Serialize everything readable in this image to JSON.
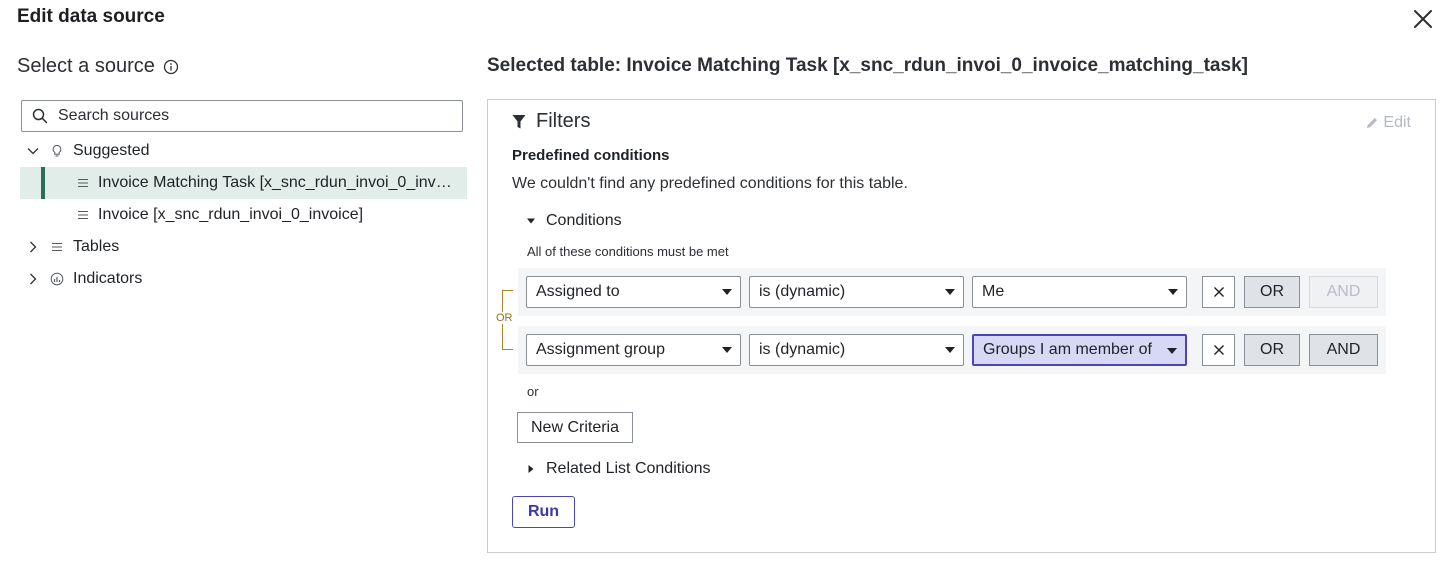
{
  "dialog": {
    "title": "Edit data source"
  },
  "left": {
    "heading": "Select a source",
    "search_placeholder": "Search sources",
    "tree": {
      "suggested_label": "Suggested",
      "suggested_items": [
        "Invoice Matching Task [x_snc_rdun_invoi_0_invoice_matching_task]",
        "Invoice [x_snc_rdun_invoi_0_invoice]"
      ],
      "tables_label": "Tables",
      "indicators_label": "Indicators"
    }
  },
  "right": {
    "heading": "Selected table: Invoice Matching Task [x_snc_rdun_invoi_0_invoice_matching_task]",
    "filters": {
      "title": "Filters",
      "edit_label": "Edit",
      "predefined_title": "Predefined conditions",
      "predefined_text": "We couldn't find any predefined conditions for this table.",
      "conditions_label": "Conditions",
      "conditions_note": "All of these conditions must be met",
      "or_bracket_label": "OR",
      "rows": [
        {
          "field": "Assigned to",
          "operator": "is (dynamic)",
          "value": "Me",
          "or_label": "OR",
          "and_label": "AND"
        },
        {
          "field": "Assignment group",
          "operator": "is (dynamic)",
          "value": "Groups I am member of",
          "or_label": "OR",
          "and_label": "AND"
        }
      ],
      "or_separator": "or",
      "new_criteria_label": "New Criteria",
      "related_list_label": "Related List Conditions",
      "run_label": "Run"
    }
  },
  "colors": {
    "selected_row_bg": "#e1ede9",
    "selected_row_accent": "#2e6e59",
    "primary": "#4a47b5",
    "highlight_value_bg": "#d7d7f6",
    "or_bracket": "#b0822a"
  }
}
